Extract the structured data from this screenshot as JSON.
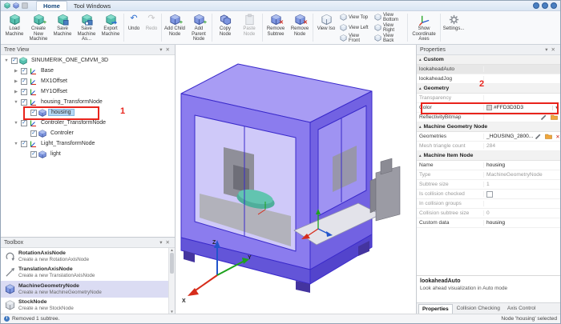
{
  "icons": {
    "check": "✓",
    "chevron_down": "▾",
    "close": "✕",
    "undo": "↶",
    "redo": "↷",
    "plus_badge": "+",
    "remove_badge": "✕",
    "dropdown": "▾",
    "section_arrow": "▴",
    "scroll_up": "▲",
    "scroll_down": "▼",
    "clear": "✕",
    "status_info": "i"
  },
  "titlebar": {
    "tabs": [
      {
        "label": "Home"
      },
      {
        "label": "Tool Windows"
      }
    ]
  },
  "ribbon": {
    "file_buttons": [
      {
        "label": "Load Machine"
      },
      {
        "label": "Create New Machine"
      },
      {
        "label": "Save Machine"
      },
      {
        "label": "Save Machine As..."
      },
      {
        "label": "Export Machine"
      }
    ],
    "undo_label": "Undo",
    "redo_label": "Redo",
    "node_buttons": [
      {
        "label": "Add Child Node"
      },
      {
        "label": "Add Parent Node"
      },
      {
        "label": "Copy Node"
      },
      {
        "label": "Paste Node"
      },
      {
        "label": "Remove Subtree"
      },
      {
        "label": "Remove Node"
      }
    ],
    "view_iso_label": "View Iso",
    "view_buttons": [
      {
        "label": "View Top"
      },
      {
        "label": "View Bottom"
      },
      {
        "label": "View Left"
      },
      {
        "label": "View Right"
      },
      {
        "label": "View Front"
      },
      {
        "label": "View Back"
      }
    ],
    "show_axes_label": "Show Coordinate Axes",
    "settings_label": "Settings..."
  },
  "tree_view": {
    "title": "Tree View",
    "nodes": [
      {
        "label": "SINUMERIK_ONE_CMVM_3D",
        "arrow": "▼"
      },
      {
        "label": "Base",
        "arrow": "▶"
      },
      {
        "label": "MX1Offset",
        "arrow": "▶"
      },
      {
        "label": "MY1Offset",
        "arrow": "▶"
      },
      {
        "label": "housing_TransformNode",
        "arrow": "▼"
      },
      {
        "label": "housing",
        "arrow": ""
      },
      {
        "label": "Controler_TransformNode",
        "arrow": "▼"
      },
      {
        "label": "Controler",
        "arrow": ""
      },
      {
        "label": "Light_TransformNode",
        "arrow": "▼"
      },
      {
        "label": "light",
        "arrow": ""
      }
    ]
  },
  "toolbox": {
    "title": "Toolbox",
    "items": [
      {
        "name": "RotationAxisNode",
        "description": "Create a new RotationAxisNode"
      },
      {
        "name": "TranslationAxisNode",
        "description": "Create a new TranslationAxisNode"
      },
      {
        "name": "MachineGeometryNode",
        "description": "Create a new MachineGeometryNode"
      },
      {
        "name": "StockNode",
        "description": "Create a new StockNode"
      }
    ]
  },
  "properties": {
    "title": "Properties",
    "sections": {
      "custom": {
        "title": "Custom"
      },
      "geometry": {
        "title": "Geometry"
      },
      "machine_geometry_node": {
        "title": "Machine Geometry Node"
      },
      "machine_item_node": {
        "title": "Machine Item Node"
      }
    },
    "rows": {
      "lookahead_auto": {
        "label": "lookaheadAuto",
        "value": ""
      },
      "lookahead_jog": {
        "label": "lookaheadJog",
        "value": ""
      },
      "transparency": {
        "label": "Transparency",
        "value": ""
      },
      "color": {
        "label": "Color",
        "value": "#FFD3D3D3",
        "swatch": "#D3D3D3"
      },
      "reflectivity_bitmap": {
        "label": "ReflectivityBitmap",
        "value": ""
      },
      "geometries": {
        "label": "Geometries",
        "value": "_HOUSING_2800..."
      },
      "mesh_triangle_count": {
        "label": "Mesh triangle count",
        "value": "284"
      },
      "name": {
        "label": "Name",
        "value": "housing"
      },
      "type": {
        "label": "Type",
        "value": "MachineGeometryNode"
      },
      "subtree_size": {
        "label": "Subtree size",
        "value": "1"
      },
      "is_collision_checked": {
        "label": "Is collision checked",
        "value": ""
      },
      "in_collision_groups": {
        "label": "In collision groups",
        "value": ""
      },
      "collision_subtree_size": {
        "label": "Collision subtree size",
        "value": "0"
      },
      "custom_data": {
        "label": "Custom data",
        "value": "housing"
      }
    },
    "description": {
      "title": "lookaheadAuto",
      "text": "Look ahead visualization in Auto mode"
    },
    "tabs": [
      {
        "label": "Properties"
      },
      {
        "label": "Collision Checking"
      },
      {
        "label": "Axis Control"
      }
    ]
  },
  "viewport": {
    "axis_labels": {
      "x": "X",
      "y": "Y",
      "z": "Z"
    }
  },
  "statusbar": {
    "left": "Removed 1 subtree.",
    "right": "Node 'housing' selected"
  },
  "annotations": {
    "step1": "1",
    "step2": "2"
  },
  "colors": {
    "annotation": "#e8241c",
    "machine_body": "#8b7cee",
    "machine_edge": "#3a2acb",
    "selection": "#b5d8f4"
  }
}
